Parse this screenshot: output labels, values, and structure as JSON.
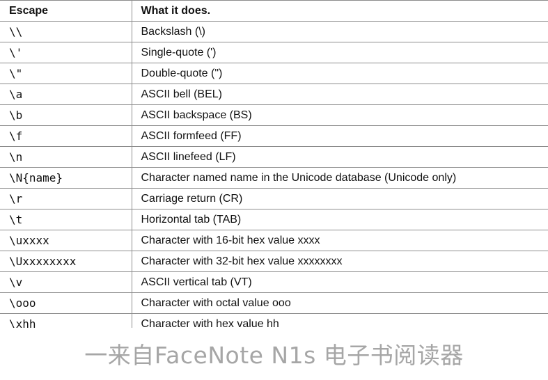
{
  "table": {
    "headers": {
      "escape": "Escape",
      "description": "What it does."
    },
    "rows": [
      {
        "escape": "\\\\",
        "description": "Backslash (\\)"
      },
      {
        "escape": "\\'",
        "description": "Single-quote (')"
      },
      {
        "escape": "\\\"",
        "description": "Double-quote (\")"
      },
      {
        "escape": "\\a",
        "description": "ASCII bell (BEL)"
      },
      {
        "escape": "\\b",
        "description": "ASCII backspace (BS)"
      },
      {
        "escape": "\\f",
        "description": "ASCII formfeed (FF)"
      },
      {
        "escape": "\\n",
        "description": "ASCII linefeed (LF)"
      },
      {
        "escape": "\\N{name}",
        "description": "Character named name in the Unicode database (Unicode only)"
      },
      {
        "escape": "\\r",
        "description": "Carriage return (CR)"
      },
      {
        "escape": "\\t",
        "description": "Horizontal tab (TAB)"
      },
      {
        "escape": "\\uxxxx",
        "description": "Character with 16-bit hex value xxxx"
      },
      {
        "escape": "\\Uxxxxxxxx",
        "description": "Character with 32-bit hex value xxxxxxxx"
      },
      {
        "escape": "\\v",
        "description": "ASCII vertical tab (VT)"
      },
      {
        "escape": "\\ooo",
        "description": "Character with octal value ooo"
      },
      {
        "escape": "\\xhh",
        "description": "Character with hex value hh"
      }
    ]
  },
  "footer": {
    "watermark": "一来自FaceNote N1s 电子书阅读器"
  }
}
